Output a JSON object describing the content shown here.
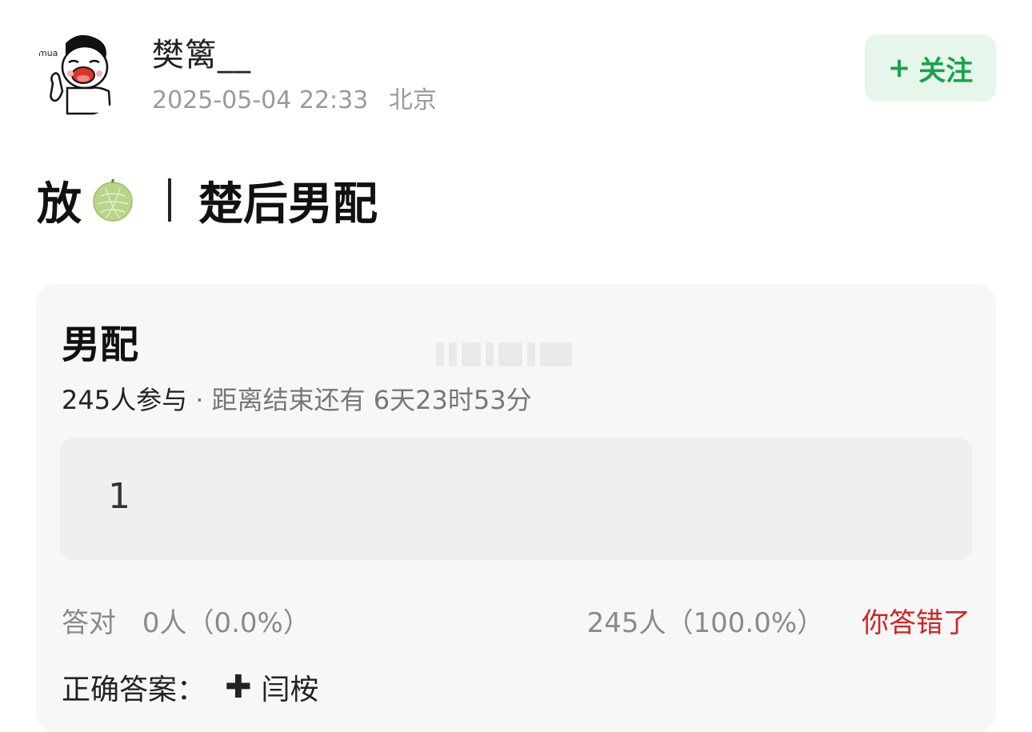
{
  "post": {
    "username": "樊篱__",
    "timestamp": "2025-05-04 22:33",
    "location": "北京",
    "follow_label": "关注",
    "follow_plus": "+",
    "title_prefix": "放",
    "title_separator": "|",
    "title_main": "楚后男配",
    "avatar_text": "mua"
  },
  "quiz": {
    "question": "男配",
    "participants": "245人参与",
    "dot": "·",
    "remaining": "距离结束还有 6天23时53分",
    "option_label": "1",
    "correct_label": "答对",
    "correct_count": "0人（0.0%）",
    "wrong_count": "245人（100.0%）",
    "wrong_status": "你答错了",
    "answer_label": "正确答案：",
    "answer_symbol": "✚",
    "answer_value": "闫桉"
  },
  "colors": {
    "follow_bg": "#e6f6ea",
    "follow_text": "#18a34a",
    "wrong_text": "#d42222",
    "card_bg": "#f7f7f7",
    "option_bg": "#efefef"
  }
}
